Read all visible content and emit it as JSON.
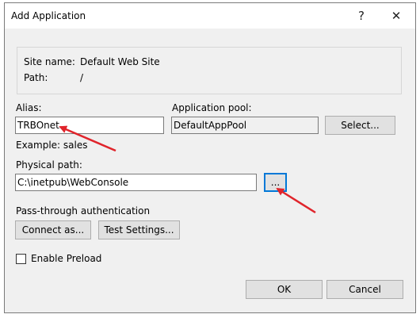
{
  "dialog": {
    "title": "Add Application",
    "help_label": "?",
    "close_label": "✕"
  },
  "site_info": {
    "site_name_label": "Site name:",
    "site_name_value": "Default Web Site",
    "path_label": "Path:",
    "path_value": "/"
  },
  "alias": {
    "label": "Alias:",
    "value": "TRBOnet",
    "example": "Example: sales"
  },
  "app_pool": {
    "label": "Application pool:",
    "value": "DefaultAppPool",
    "select_label": "Select..."
  },
  "physical_path": {
    "label": "Physical path:",
    "value": "C:\\inetpub\\WebConsole",
    "browse_label": "..."
  },
  "auth": {
    "label": "Pass-through authentication",
    "connect_as_label": "Connect as...",
    "test_settings_label": "Test Settings..."
  },
  "preload": {
    "label": "Enable Preload",
    "checked": false
  },
  "footer": {
    "ok_label": "OK",
    "cancel_label": "Cancel"
  },
  "colors": {
    "annotation_arrow": "#e0242b",
    "focus_border": "#0078d7"
  }
}
